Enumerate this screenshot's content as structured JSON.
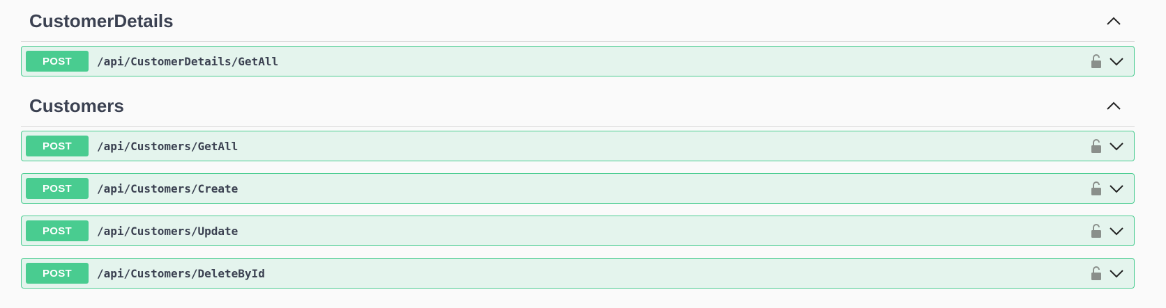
{
  "sections": [
    {
      "title": "CustomerDetails",
      "operations": [
        {
          "method": "POST",
          "path": "/api/CustomerDetails/GetAll"
        }
      ]
    },
    {
      "title": "Customers",
      "operations": [
        {
          "method": "POST",
          "path": "/api/Customers/GetAll"
        },
        {
          "method": "POST",
          "path": "/api/Customers/Create"
        },
        {
          "method": "POST",
          "path": "/api/Customers/Update"
        },
        {
          "method": "POST",
          "path": "/api/Customers/DeleteById"
        }
      ]
    }
  ],
  "icons": {
    "collapse": "chevron-up-icon",
    "expand": "chevron-down-icon",
    "lock": "unlocked-padlock-icon"
  },
  "colors": {
    "post_method": "#49cc90",
    "post_block_bg": "#e8f6ef",
    "section_title": "#3b4151",
    "lock_gray": "#8a8f8b"
  }
}
